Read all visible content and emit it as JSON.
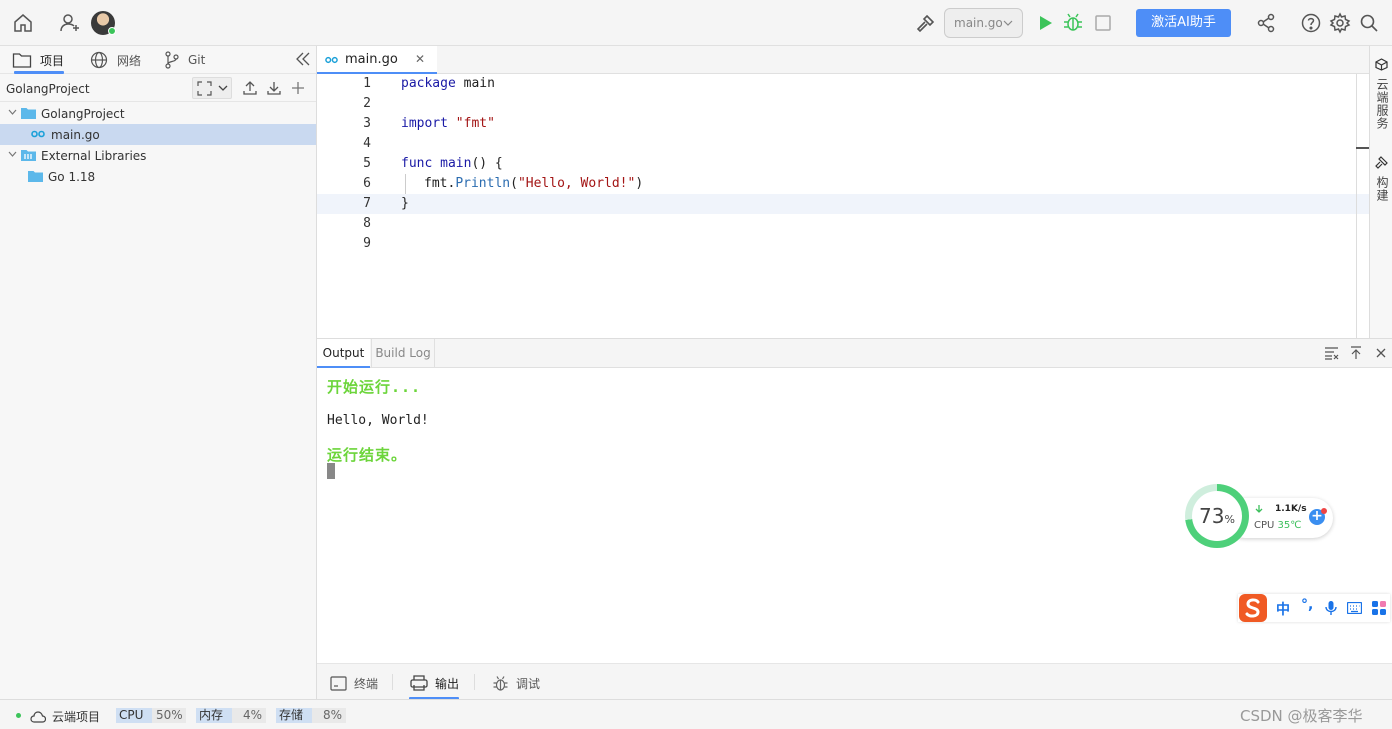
{
  "toolbar": {
    "run_config": "main.go",
    "ai_button": "激活AI助手"
  },
  "left_tabs": [
    {
      "label": "项目",
      "icon": "folder-icon"
    },
    {
      "label": "网络",
      "icon": "globe-icon"
    },
    {
      "label": "Git",
      "icon": "git-icon"
    }
  ],
  "project": {
    "name": "GolangProject",
    "tree": [
      {
        "label": "GolangProject",
        "icon": "folder-icon"
      },
      {
        "label": "main.go",
        "icon": "go-file-icon",
        "selected": true
      },
      {
        "label": "External Libraries",
        "icon": "library-icon"
      },
      {
        "label": "Go 1.18",
        "icon": "folder-icon"
      }
    ]
  },
  "editor": {
    "tab_label": "main.go",
    "lines": [
      {
        "n": "1"
      },
      {
        "n": "2"
      },
      {
        "n": "3"
      },
      {
        "n": "4"
      },
      {
        "n": "5"
      },
      {
        "n": "6"
      },
      {
        "n": "7"
      },
      {
        "n": "8"
      },
      {
        "n": "9"
      }
    ],
    "code": {
      "l1_kw": "package",
      "l1_rest": " main",
      "l3_kw": "import",
      "l3_str": " \"fmt\"",
      "l5_kw": "func",
      "l5_fn": " main",
      "l5_rest": "() {",
      "l6_pkg": "fmt.",
      "l6_call": "Println",
      "l6_open": "(",
      "l6_str": "\"Hello, World!\"",
      "l6_close": ")",
      "l7": "}"
    }
  },
  "right_strip": {
    "cloud_service": "云端服务",
    "build": "构建"
  },
  "output": {
    "tabs": [
      "Output",
      "Build Log"
    ],
    "start": "开始运行...",
    "result": "Hello, World!",
    "end": "运行结束。"
  },
  "cpu_widget": {
    "percent": "73",
    "percent_unit": "%",
    "net_speed": "1.1K/s",
    "cpu_label": "CPU",
    "cpu_temp": "35℃"
  },
  "ime": {
    "mode": "中",
    "punct": "°,"
  },
  "bottom_tabs": [
    {
      "label": "终端",
      "icon": "terminal-icon"
    },
    {
      "label": "输出",
      "icon": "printer-icon"
    },
    {
      "label": "调试",
      "icon": "bug-icon"
    }
  ],
  "status": {
    "project_type": "云端项目",
    "cpu_label": "CPU",
    "cpu_value": "50%",
    "mem_label": "内存",
    "mem_value": "4%",
    "storage_label": "存储",
    "storage_value": "8%",
    "watermark": "CSDN @极客李华"
  }
}
